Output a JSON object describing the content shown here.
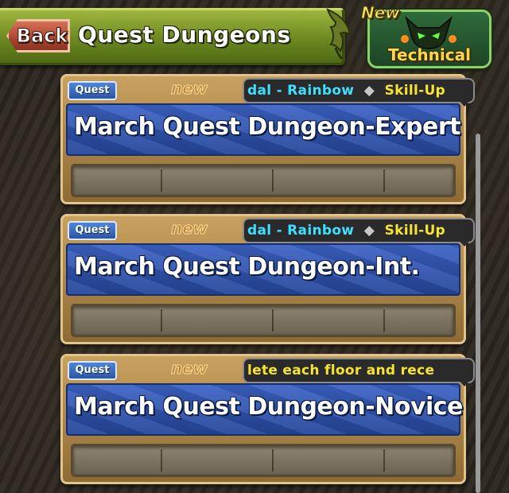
{
  "header": {
    "back_label": "Back",
    "title": "Quest Dungeons",
    "badge_new": "New",
    "badge_label": "Technical"
  },
  "dungeons": [
    {
      "tag": "Quest",
      "new": "new",
      "ticker_a": "dal - Rainbow",
      "ticker_b": "Skill-Up",
      "name": "March Quest Dungeon-Expert"
    },
    {
      "tag": "Quest",
      "new": "new",
      "ticker_a": "dal - Rainbow",
      "ticker_b": "Skill-Up",
      "name": "March Quest Dungeon-Int."
    },
    {
      "tag": "Quest",
      "new": "new",
      "ticker_a": "lete each floor and rece",
      "ticker_b": "",
      "name": "March Quest Dungeon-Novice"
    }
  ],
  "colors": {
    "header_green": "#6c8820",
    "back_red": "#a84530",
    "panel_blue": "#26469a",
    "ticker_cyan": "#3de0ff",
    "ticker_yellow": "#f6e42e",
    "badge_gold": "#f7d94a"
  }
}
